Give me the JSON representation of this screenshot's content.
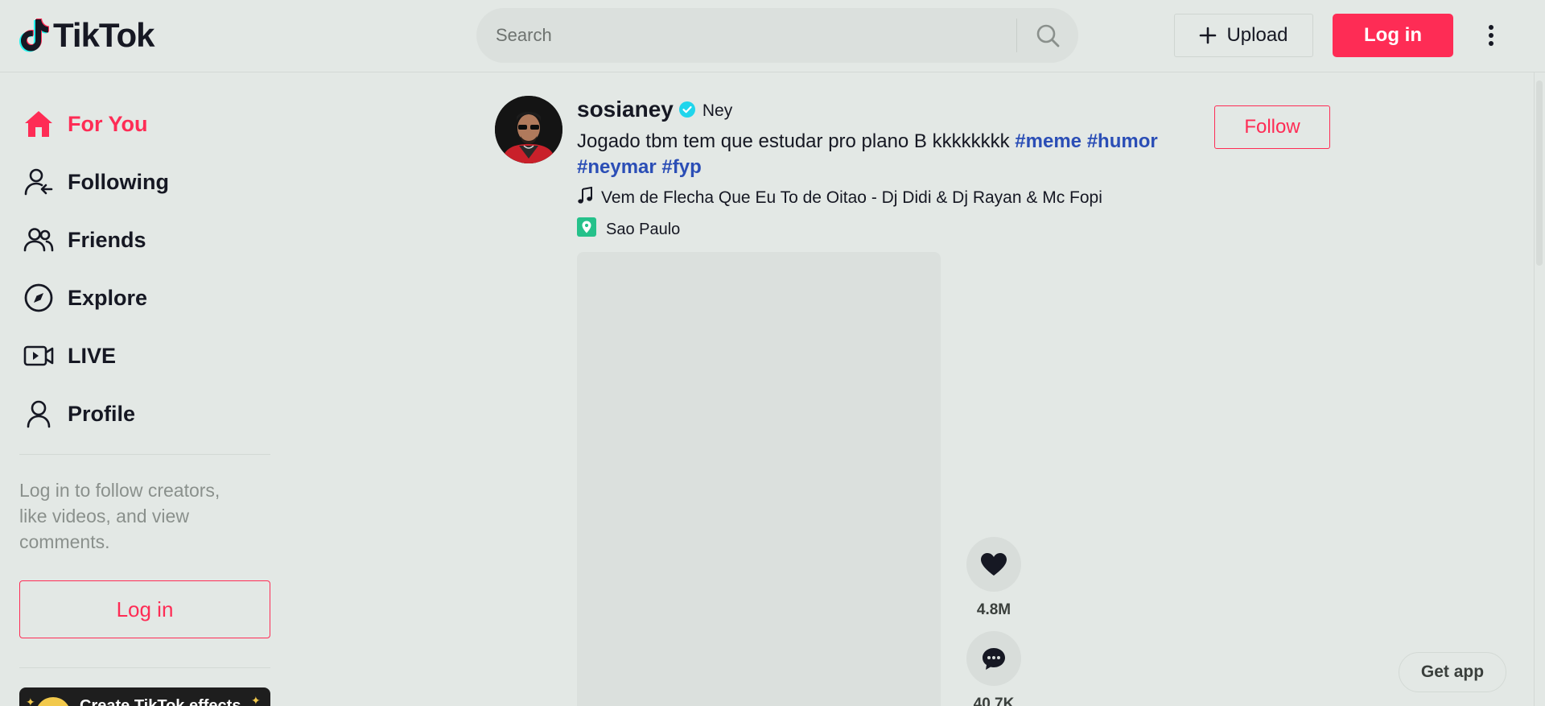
{
  "header": {
    "logo_text": "TikTok",
    "search_placeholder": "Search",
    "upload_label": "Upload",
    "login_label": "Log in"
  },
  "sidebar": {
    "items": [
      {
        "label": "For You",
        "icon": "home-icon",
        "active": true
      },
      {
        "label": "Following",
        "icon": "following-icon",
        "active": false
      },
      {
        "label": "Friends",
        "icon": "friends-icon",
        "active": false
      },
      {
        "label": "Explore",
        "icon": "compass-icon",
        "active": false
      },
      {
        "label": "LIVE",
        "icon": "live-icon",
        "active": false
      },
      {
        "label": "Profile",
        "icon": "profile-icon",
        "active": false
      }
    ],
    "login_prompt": "Log in to follow creators, like videos, and view comments.",
    "login_label": "Log in",
    "effects_banner": "Create TikTok effects"
  },
  "post": {
    "username": "sosianey",
    "nickname": "Ney",
    "caption_text": "Jogado tbm tem que estudar pro plano B kkkkkkkk ",
    "hashtags": [
      "#meme",
      "#humor",
      "#neymar",
      "#fyp"
    ],
    "music": "Vem de Flecha Que Eu To de Oitao - Dj Didi & Dj Rayan & Mc Fopi",
    "location": "Sao Paulo",
    "follow_label": "Follow",
    "likes": "4.8M",
    "comments": "40.7K"
  },
  "get_app_label": "Get app",
  "colors": {
    "accent": "#fe2c55",
    "hashtag": "#2b4eb6",
    "verified": "#20d5ec",
    "location_badge": "#25c18a",
    "background": "#e3e8e5"
  }
}
